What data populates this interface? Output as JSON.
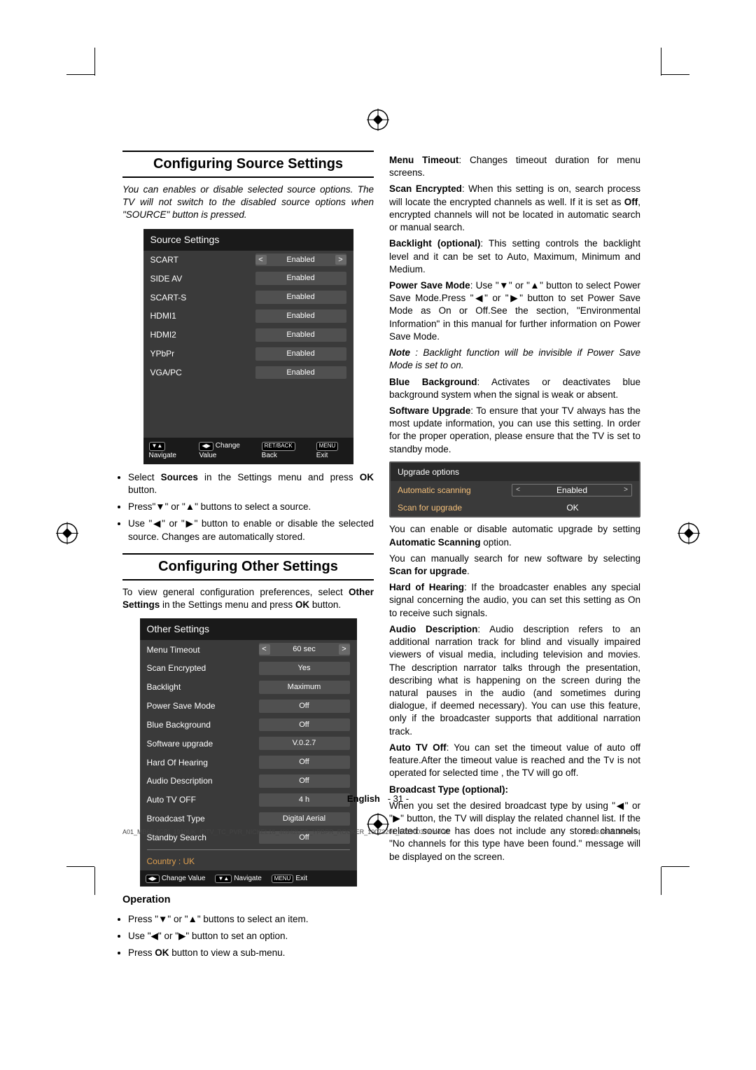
{
  "left": {
    "section1_title": "Configuring Source Settings",
    "intro": "You can enables or disable selected source options. The TV will not switch to the disabled source options when \"SOURCE\" button is pressed.",
    "source_osd": {
      "title": "Source Settings",
      "rows": [
        {
          "label": "SCART",
          "value": "Enabled",
          "selected": true
        },
        {
          "label": "SIDE AV",
          "value": "Enabled",
          "selected": false
        },
        {
          "label": "SCART-S",
          "value": "Enabled",
          "selected": false
        },
        {
          "label": "HDMI1",
          "value": "Enabled",
          "selected": false
        },
        {
          "label": "HDMI2",
          "value": "Enabled",
          "selected": false
        },
        {
          "label": "YPbPr",
          "value": "Enabled",
          "selected": false
        },
        {
          "label": "VGA/PC",
          "value": "Enabled",
          "selected": false
        }
      ],
      "footer": [
        {
          "icon": "▼▲",
          "text": "Navigate"
        },
        {
          "icon": "◀▶",
          "text": "Change Value"
        },
        {
          "icon": "RET/BACK",
          "text": "Back"
        },
        {
          "icon": "MENU",
          "text": "Exit"
        }
      ]
    },
    "bullets1": [
      "Select <b>Sources</b> in the Settings menu and press <b>OK</b> button.",
      "Press\"▼\" or \"▲\" buttons to select a source.",
      "Use \"◀\" or \"▶\" button to enable or disable the selected source. Changes are automatically stored."
    ],
    "section2_title": "Configuring Other Settings",
    "section2_intro": "To view general configuration preferences, select <b>Other Settings</b> in the Settings menu and press <b>OK</b> button.",
    "other_osd": {
      "title": "Other Settings",
      "rows": [
        {
          "label": "Menu Timeout",
          "value": "60 sec",
          "selected": true
        },
        {
          "label": "Scan Encrypted",
          "value": "Yes",
          "selected": false
        },
        {
          "label": "Backlight",
          "value": "Maximum",
          "selected": false
        },
        {
          "label": "Power Save Mode",
          "value": "Off",
          "selected": false
        },
        {
          "label": "Blue Background",
          "value": "Off",
          "selected": false
        },
        {
          "label": "Software upgrade",
          "value": "V.0.2.7",
          "selected": false
        },
        {
          "label": "Hard Of Hearing",
          "value": "Off",
          "selected": false
        },
        {
          "label": "Audio Description",
          "value": "Off",
          "selected": false
        },
        {
          "label": "Auto TV OFF",
          "value": "4 h",
          "selected": false
        },
        {
          "label": "Broadcast Type",
          "value": "Digital Aerial",
          "selected": false
        },
        {
          "label": "Standby Search",
          "value": "Off",
          "selected": false
        }
      ],
      "country": "Country : UK",
      "footer": [
        {
          "icon": "◀▶",
          "text": "Change Value"
        },
        {
          "icon": "▼▲",
          "text": "Navigate"
        },
        {
          "icon": "MENU",
          "text": "Exit"
        }
      ]
    },
    "operation_title": "Operation",
    "operation_bullets": [
      "Press \"▼\" or \"▲\" buttons to select an item.",
      "Use \"◀\" or \"▶\" button to set an option.",
      "Press <b>OK</b> button to view a sub-menu."
    ]
  },
  "right": {
    "p_menu_timeout": "<b>Menu Timeout</b>: Changes timeout duration for menu screens.",
    "p_scan_encrypted": "<b>Scan Encrypted</b>: When this setting is on, search process will locate the encrypted channels as well. If it is set as <b>Off</b>, encrypted channels will not be located in automatic search or manual search.",
    "p_backlight": "<b>Backlight (optional)</b>: This setting controls the backlight level and it can be set to Auto, Maximum, Minimum and Medium.",
    "p_power_save": "<b>Power Save Mode</b>: Use \"▼\" or \"▲\" button to select Power Save Mode.Press \"◀\" or \"▶\" button to set Power Save Mode as On or Off.See the section, \"Environmental Information\" in this manual for further information on Power Save Mode.",
    "p_note": "<b><i>Note</i></b><i> : Backlight function will be invisible if Power Save Mode is set to on.</i>",
    "p_blue": "<b>Blue Background</b>: Activates or deactivates blue background system when the signal is weak or absent.",
    "p_software": "<b>Software Upgrade</b>: To ensure that your TV always has the most update information, you can use this setting. In order for the proper operation, please ensure that the TV is set to standby mode.",
    "upgrade_osd": {
      "title": "Upgrade options",
      "rows": [
        {
          "label": "Automatic scanning",
          "value": "Enabled",
          "arrows": true
        },
        {
          "label": "Scan for upgrade",
          "value": "OK",
          "arrows": false
        }
      ]
    },
    "p_auto_scan": "You can enable or disable automatic upgrade by setting <b>Automatic Scanning</b> option.",
    "p_manual": "You can manually search for new software by selecting <b>Scan for upgrade</b>.",
    "p_hoh": "<b>Hard of Hearing</b>: If the broadcaster enables any special signal concerning the audio, you can set this setting as On to receive such signals.",
    "p_audio_desc": "<b>Audio Description</b>: Audio description refers to an additional narration track for blind and visually impaired viewers of visual media, including television and movies. The description narrator talks through the presentation, describing what is happening on the screen during the natural pauses in the audio (and sometimes during dialogue, if deemed necessary). You can use this feature, only if the broadcaster supports that additional narration track.",
    "p_auto_tv_off": "<b>Auto TV Off</b>: You can set the timeout value of auto off feature.After the timeout value is reached and the Tv is not operated for selected time , the TV will go off.",
    "p_broadcast_type_title": "Broadcast Type (optional):",
    "p_broadcast_type": "When you set the desired broadcast type by using \"◀\" or \"▶\" button, the TV will display the related channel list. If the related source has does not include any stored channels, \"No channels for this type have been found.\" message will be displayed on the screen."
  },
  "footer": {
    "lang": "English",
    "page": "- 31 -",
    "imprint_left": "A01_MB60_[GB]_1910UK_IDTV_TC_PVR_NICKEL16_40942LED_YPBPR_ROCKER_10073201_50190037.indd   31",
    "imprint_right": "03.08.2011   08:49:04"
  }
}
